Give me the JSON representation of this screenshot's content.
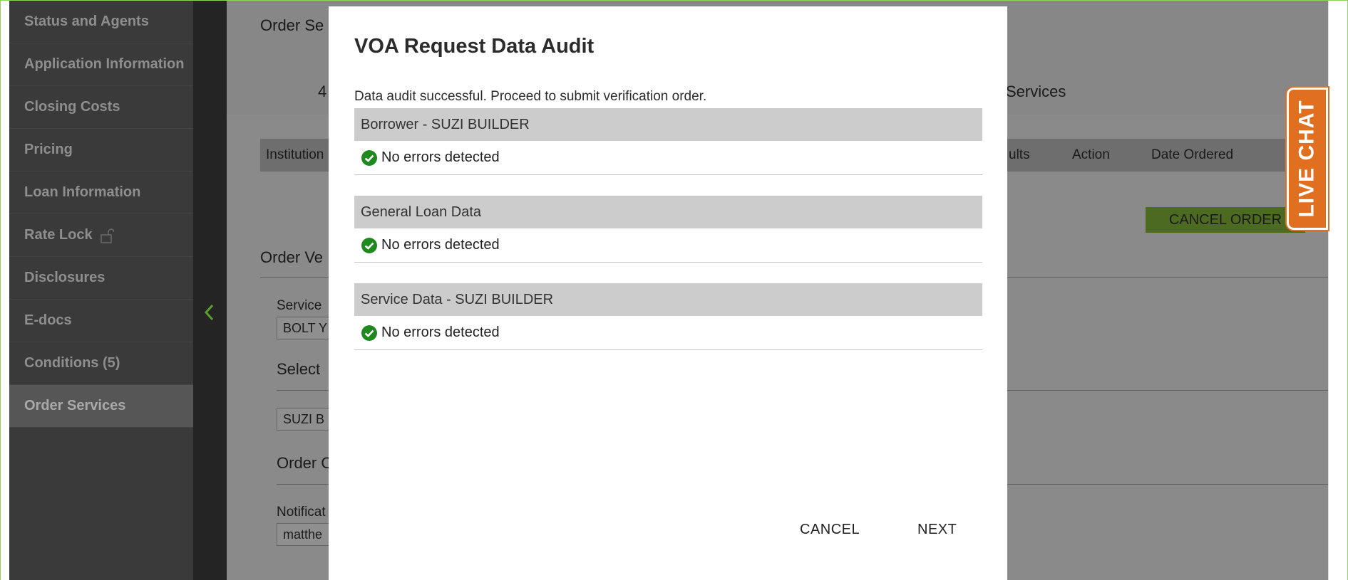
{
  "sidebar": {
    "items": [
      {
        "label": "Status and Agents"
      },
      {
        "label": "Application Information"
      },
      {
        "label": "Closing Costs"
      },
      {
        "label": "Pricing"
      },
      {
        "label": "Loan Information"
      },
      {
        "label": "Rate Lock"
      },
      {
        "label": "Disclosures"
      },
      {
        "label": "E-docs"
      },
      {
        "label": "Conditions (5)"
      },
      {
        "label": "Order Services"
      }
    ],
    "active": "Order Services"
  },
  "background": {
    "page_title_partial": "Order Se",
    "header_number_partial": "4",
    "header_services_partial": "Services",
    "table_headers": {
      "institution": "Institution",
      "results_partial": "ults",
      "action": "Action",
      "date_ordered": "Date Ordered"
    },
    "cancel_order_label": "CANCEL ORDER",
    "order_ve_partial": "Order Ve",
    "service_label_partial": "Service",
    "service_value_partial": "BOLT Y",
    "select_partial": "Select",
    "select_value_partial": "SUZI B",
    "order_o_partial": "Order O",
    "notification_partial": "Notificat",
    "notification_value_partial": "matthe"
  },
  "live_chat_label": "LIVE CHAT",
  "modal": {
    "title": "VOA Request Data Audit",
    "message": "Data audit successful. Proceed to submit verification order.",
    "sections": [
      {
        "heading": "Borrower - SUZI BUILDER",
        "status": "No errors detected"
      },
      {
        "heading": "General Loan Data",
        "status": "No errors detected"
      },
      {
        "heading": "Service Data - SUZI BUILDER",
        "status": "No errors detected"
      }
    ],
    "cancel_label": "CANCEL",
    "next_label": "NEXT"
  },
  "colors": {
    "success": "#1e8a1e",
    "accent_green": "#4c6a20",
    "live_chat": "#e07020",
    "sidebar_bg": "#3a3a3a"
  }
}
